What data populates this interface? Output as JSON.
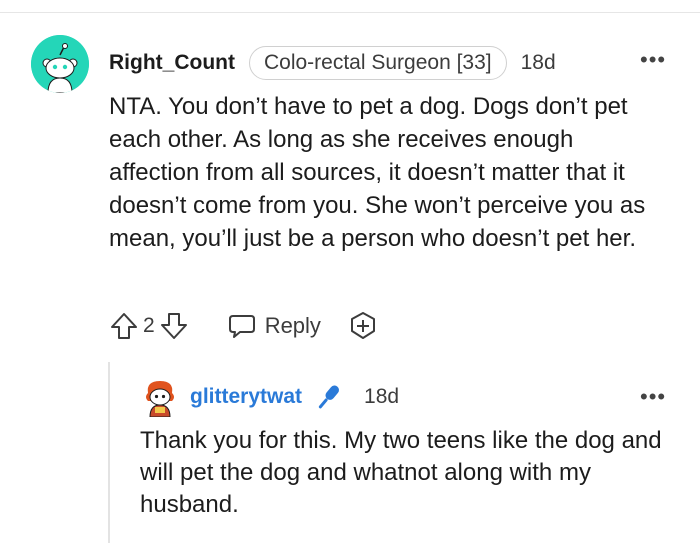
{
  "comment": {
    "username": "Right_Count",
    "flair": "Colo-rectal Surgeon [33]",
    "age": "18d",
    "more_label": "•••",
    "body": "NTA. You don’t have to pet a dog. Dogs don’t pet each other. As long as she receives enough affection from all sources, it doesn’t matter that it doesn’t come from you. She won’t perceive you as mean, you’ll just be a person who doesn’t pet her.",
    "vote_count": "2",
    "reply_label": "Reply",
    "avatar_color": "#24d6b8"
  },
  "reply": {
    "username": "glitterytwat",
    "age": "18d",
    "more_label": "•••",
    "body": "Thank you for this. My two teens like the dog and will pet the dog and whatnot along with my husband.",
    "username_color": "#2a7ad8"
  },
  "icons": {
    "upvote": "arrow-up-icon",
    "downvote": "arrow-down-icon",
    "reply": "speech-bubble-icon",
    "award": "add-award-icon",
    "mic": "microphone-icon"
  }
}
